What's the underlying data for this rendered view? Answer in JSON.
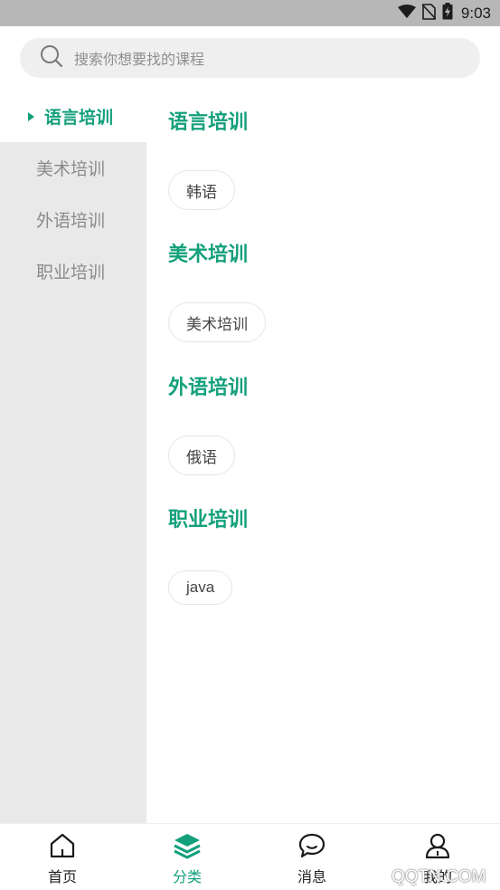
{
  "status_bar": {
    "time": "9:03",
    "icons": [
      "wifi-icon",
      "no-sim-icon",
      "battery-charging-icon"
    ]
  },
  "search": {
    "placeholder": "搜索你想要找的课程",
    "icon": "search-icon"
  },
  "sidebar": {
    "items": [
      {
        "label": "语言培训",
        "active": true
      },
      {
        "label": "美术培训",
        "active": false
      },
      {
        "label": "外语培训",
        "active": false
      },
      {
        "label": "职业培训",
        "active": false
      }
    ]
  },
  "content": {
    "sections": [
      {
        "title": "语言培训",
        "tags": [
          "韩语"
        ]
      },
      {
        "title": "美术培训",
        "tags": [
          "美术培训"
        ]
      },
      {
        "title": "外语培训",
        "tags": [
          "俄语"
        ]
      },
      {
        "title": "职业培训",
        "tags": [
          "java"
        ]
      }
    ]
  },
  "tabbar": {
    "tabs": [
      {
        "label": "首页",
        "icon": "home-icon",
        "active": false
      },
      {
        "label": "分类",
        "icon": "layers-icon",
        "active": true
      },
      {
        "label": "消息",
        "icon": "chat-bubble-icon",
        "active": false
      },
      {
        "label": "我的",
        "icon": "user-icon",
        "active": false
      }
    ]
  },
  "watermark": "QQTN.COM",
  "colors": {
    "accent": "#13a07b",
    "sidebar_bg": "#e9e9e9",
    "status_bar_bg": "#b7b7b7",
    "search_bg": "#efefef"
  }
}
